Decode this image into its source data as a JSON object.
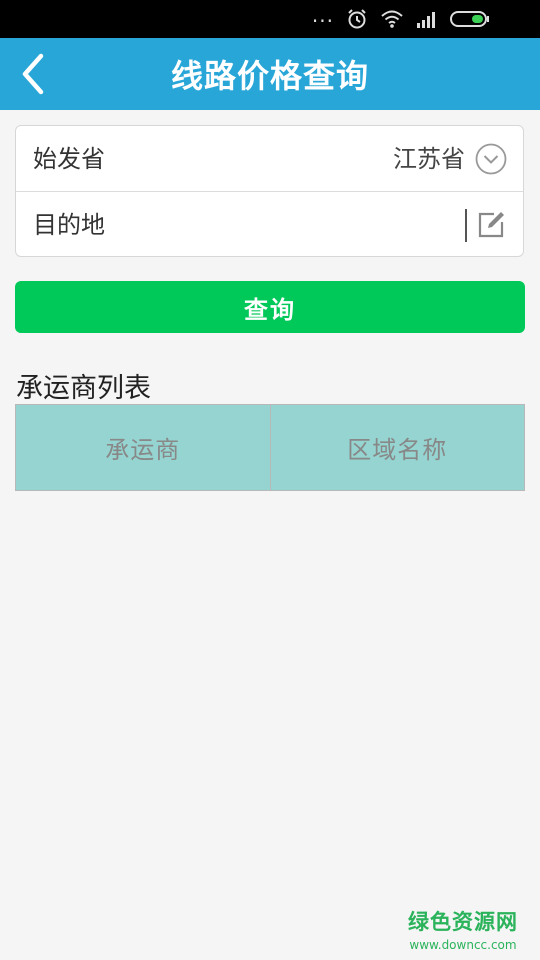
{
  "status_bar": {
    "icons": [
      "more-dots-icon",
      "alarm-icon",
      "wifi-icon",
      "signal-icon",
      "battery-icon"
    ],
    "dots": "..."
  },
  "header": {
    "title": "线路价格查询",
    "back_icon": "chevron-left-icon",
    "background": "#29a6d8"
  },
  "form": {
    "origin_label": "始发省",
    "origin_value": "江苏省",
    "origin_icon": "chevron-down-circle-icon",
    "destination_label": "目的地",
    "destination_value": "",
    "destination_icon": "edit-icon"
  },
  "query_button": {
    "label": "查询",
    "color": "#00c95a"
  },
  "carrier_list": {
    "title": "承运商列表",
    "columns": [
      "承运商",
      "区域名称"
    ],
    "header_color": "#95d4d0",
    "rows": []
  },
  "watermark": {
    "text": "绿色资源网",
    "url": "www.downcc.com"
  }
}
